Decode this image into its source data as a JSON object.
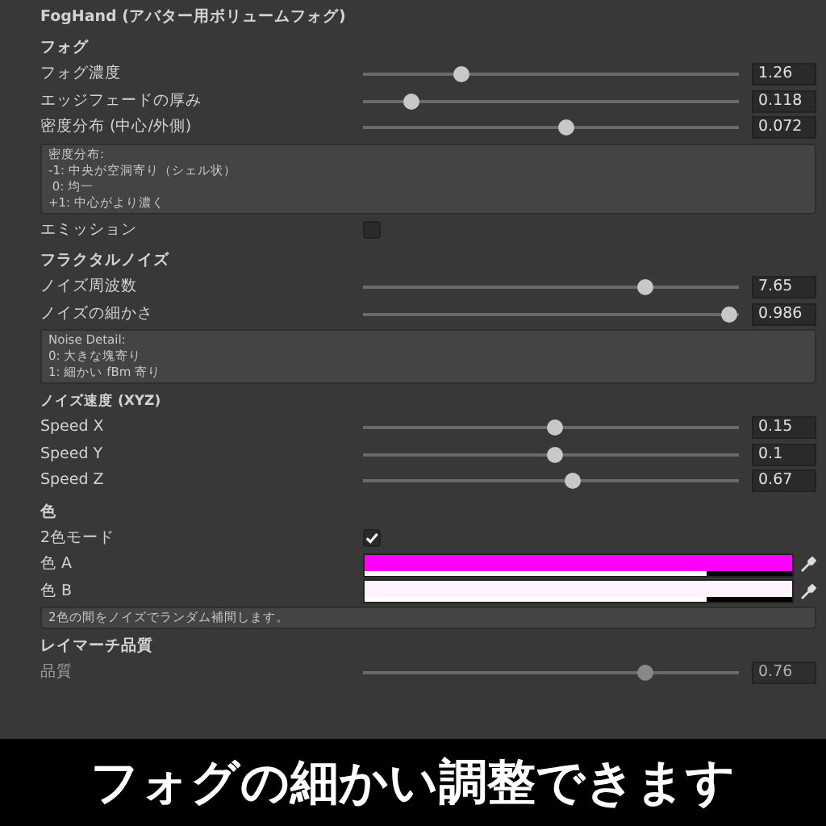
{
  "window": {
    "title": "FogHand (アバター用ボリュームフォグ)"
  },
  "sections": [
    {
      "title": "フォグ",
      "rows": [
        {
          "kind": "slider",
          "label": "フォグ濃度",
          "level": 0.26,
          "value": "1.26",
          "disabled": false
        },
        {
          "kind": "slider",
          "label": "エッジフェードの厚み",
          "level": 0.13,
          "value": "0.118",
          "disabled": false
        },
        {
          "kind": "slider",
          "label": "密度分布 (中心/外側)",
          "level": 0.54,
          "value": "0.072",
          "disabled": false
        },
        {
          "kind": "help",
          "lines": [
            "密度分布:",
            "-1: 中央が空洞寄り（シェル状）",
            " 0: 均一",
            "+1: 中心がより濃く"
          ]
        },
        {
          "kind": "checkbox",
          "label": "エミッション",
          "checked": false
        }
      ]
    },
    {
      "title": "フラクタルノイズ",
      "rows": [
        {
          "kind": "slider",
          "label": "ノイズ周波数",
          "level": 0.75,
          "value": "7.65",
          "disabled": false
        },
        {
          "kind": "slider",
          "label": "ノイズの細かさ",
          "level": 0.975,
          "value": "0.986",
          "disabled": false
        },
        {
          "kind": "help",
          "lines": [
            "Noise Detail:",
            "0: 大きな塊寄り",
            "1: 細かい fBm 寄り"
          ]
        }
      ]
    },
    {
      "title": "ノイズ速度 (XYZ)",
      "small": true,
      "rows": [
        {
          "kind": "slider",
          "label": "Speed X",
          "level": 0.51,
          "value": "0.15",
          "disabled": false
        },
        {
          "kind": "slider",
          "label": "Speed Y",
          "level": 0.51,
          "value": "0.1",
          "disabled": false
        },
        {
          "kind": "slider",
          "label": "Speed Z",
          "level": 0.56,
          "value": "0.67",
          "disabled": false
        }
      ]
    },
    {
      "title": "色",
      "rows": [
        {
          "kind": "checkbox",
          "label": "2色モード",
          "checked": true
        },
        {
          "kind": "color",
          "label": "色 A",
          "color": "#ff00ff",
          "level": 0.8
        },
        {
          "kind": "color",
          "label": "色 B",
          "color": "#fff4fd",
          "level": 0.8
        },
        {
          "kind": "help",
          "lines": [
            "2色の間をノイズでランダム補間します。"
          ]
        }
      ]
    },
    {
      "title": "レイマーチ品質",
      "rows": [
        {
          "kind": "slider",
          "label": "品質",
          "level": 0.75,
          "value": "0.76",
          "disabled": true
        }
      ]
    }
  ],
  "caption": "フォグの細かい調整できます"
}
